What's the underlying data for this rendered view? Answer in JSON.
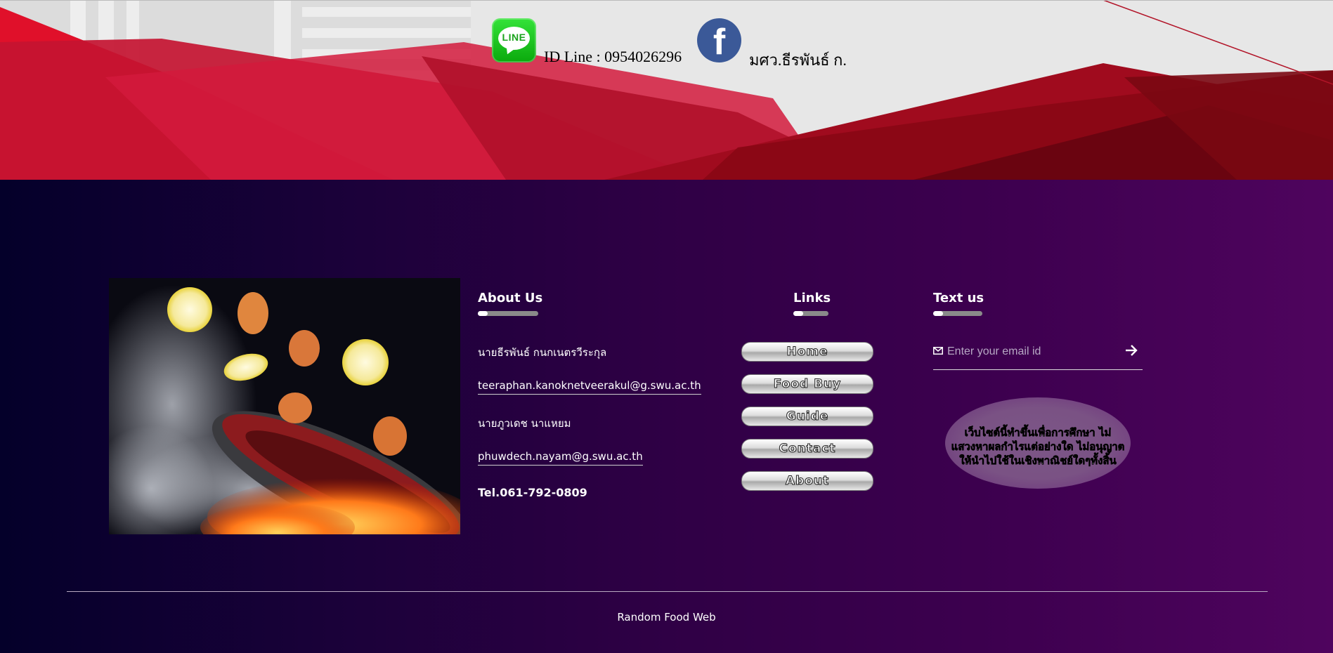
{
  "header": {
    "line_logo_text": "LINE",
    "line_contact": "ID Line : 0954026296",
    "facebook_logo_text": "f",
    "facebook_contact": "มศว.ธีรพันธ์ ก."
  },
  "colors": {
    "line_green": "#0aa90c",
    "facebook_blue": "#3b5998",
    "banner_red": "#c8102e",
    "footer_dark": "#04002a",
    "footer_purple": "#4f045e"
  },
  "about": {
    "title": "About Us",
    "lines": [
      "นายธีรพันธ์ กนกเนตรวีระกุล",
      "teeraphan.kanoknetveerakul@g.swu.ac.th",
      "นายภูวเดช นาแหยม",
      "phuwdech.nayam@g.swu.ac.th",
      "Tel.061-792-0809"
    ]
  },
  "links": {
    "title": "Links",
    "items": [
      "Home",
      "Food Buy",
      "Guide",
      "Contact",
      "About"
    ]
  },
  "text_us": {
    "title": "Text us",
    "placeholder": "Enter your email id",
    "notice": "เว็บไซต์นี้ทำขึ้นเพื่อการศึกษา ไม่แสวงหาผลกำไรแต่อย่างใด ไม่อนุญาตให้นำไปใช้ในเชิงพาณิชย์ใดๆทั้งสิ้น"
  },
  "footer": {
    "copyright": "Random Food Web"
  },
  "icons": [
    "line-logo-icon",
    "facebook-logo-icon",
    "mail-icon",
    "arrow-right-icon"
  ]
}
